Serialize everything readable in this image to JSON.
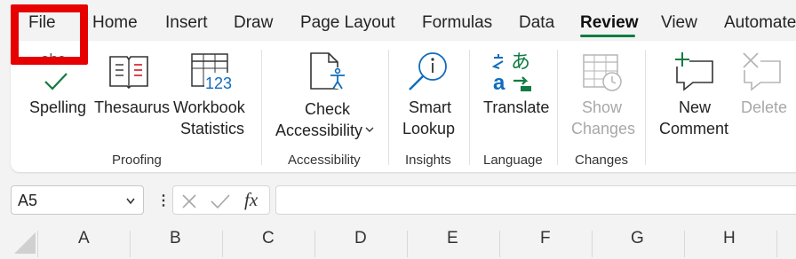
{
  "tabs": {
    "items": [
      "File",
      "Home",
      "Insert",
      "Draw",
      "Page Layout",
      "Formulas",
      "Data",
      "Review",
      "View",
      "Automate"
    ],
    "active": "Review"
  },
  "ribbon": {
    "proofing": {
      "spelling": "Spelling",
      "spelling_icon_text": "abc",
      "thesaurus": "Thesaurus",
      "workbook_statistics_line1": "Workbook",
      "workbook_statistics_line2": "Statistics",
      "workbook_statistics_icon_text": "123",
      "label": "Proofing"
    },
    "accessibility": {
      "check_line1": "Check",
      "check_line2": "Accessibility",
      "label": "Accessibility"
    },
    "insights": {
      "smart_lookup_line1": "Smart",
      "smart_lookup_line2": "Lookup",
      "label": "Insights"
    },
    "language": {
      "translate": "Translate",
      "label": "Language"
    },
    "changes": {
      "show_changes_line1": "Show",
      "show_changes_line2": "Changes",
      "label": "Changes"
    },
    "comments": {
      "new_comment_line1": "New",
      "new_comment_line2": "Comment",
      "delete": "Delete"
    }
  },
  "formula_bar": {
    "name_box": "A5",
    "fx": "fx",
    "formula": ""
  },
  "columns": [
    "A",
    "B",
    "C",
    "D",
    "E",
    "F",
    "G",
    "H"
  ],
  "colors": {
    "accent": "#107c41",
    "highlight": "#e60000",
    "icon_blue": "#0f6cbd",
    "disabled": "#a8a8a8"
  }
}
